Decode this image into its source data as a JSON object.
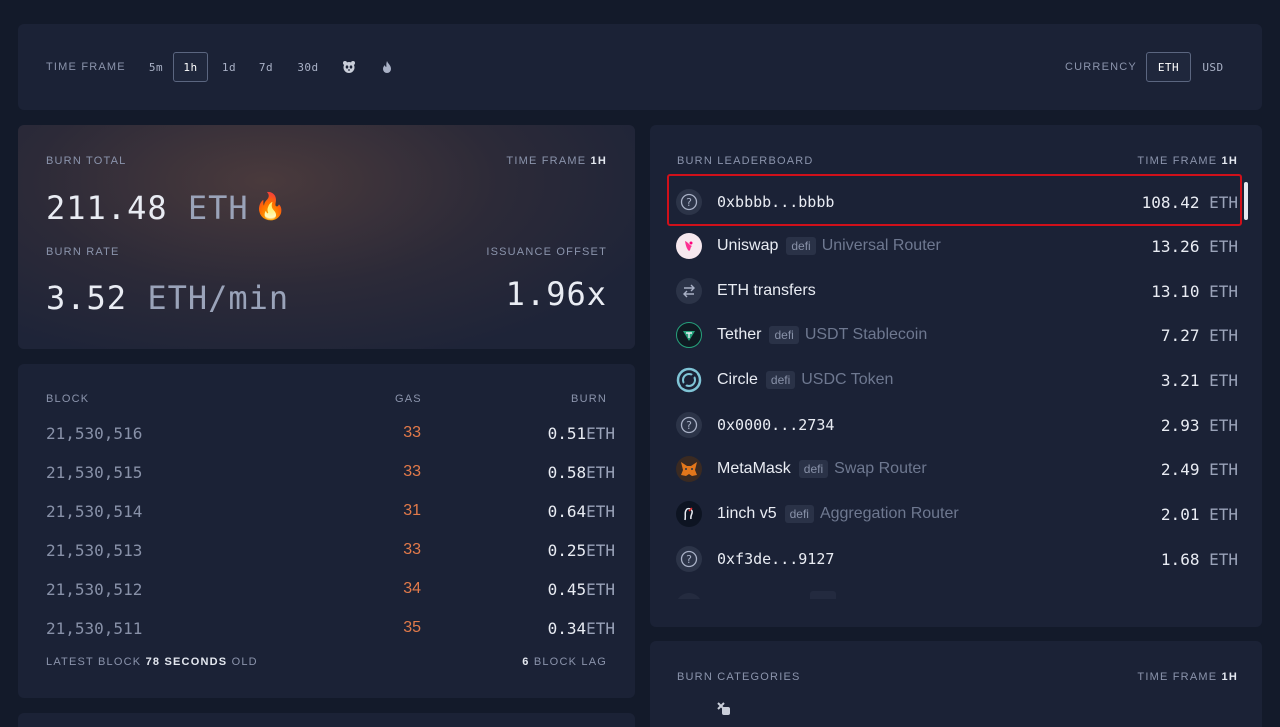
{
  "time_frame_bar": {
    "label": "TIME FRAME",
    "options": [
      "5m",
      "1h",
      "1d",
      "7d",
      "30d"
    ],
    "selected": "1h",
    "extra_icons": [
      "panda-icon",
      "fire-icon"
    ],
    "currency_label": "CURRENCY",
    "currency_options": [
      "ETH",
      "USD"
    ],
    "currency_selected": "ETH"
  },
  "burn_total": {
    "label": "BURN TOTAL",
    "time_frame_label": "TIME FRAME",
    "time_frame_value": "1h",
    "value": "211.48",
    "unit": "ETH",
    "emoji": "🔥",
    "burn_rate_label": "BURN RATE",
    "burn_rate_value": "3.52",
    "burn_rate_unit": "ETH/min",
    "issuance_offset_label": "ISSUANCE OFFSET",
    "issuance_offset_value": "1.96x"
  },
  "blocks": {
    "headers": {
      "block": "BLOCK",
      "gas": "GAS",
      "burn": "BURN"
    },
    "rows": [
      {
        "block": "21,530,516",
        "gas": "33",
        "burn": "0.51",
        "unit": "ETH"
      },
      {
        "block": "21,530,515",
        "gas": "33",
        "burn": "0.58",
        "unit": "ETH"
      },
      {
        "block": "21,530,514",
        "gas": "31",
        "burn": "0.64",
        "unit": "ETH"
      },
      {
        "block": "21,530,513",
        "gas": "33",
        "burn": "0.25",
        "unit": "ETH"
      },
      {
        "block": "21,530,512",
        "gas": "34",
        "burn": "0.45",
        "unit": "ETH"
      },
      {
        "block": "21,530,511",
        "gas": "35",
        "burn": "0.34",
        "unit": "ETH"
      }
    ],
    "footer_latest_prefix": "LATEST BLOCK",
    "footer_latest_value": "78",
    "footer_latest_unit": "SECONDS",
    "footer_latest_suffix": "OLD",
    "footer_lag_value": "6",
    "footer_lag_label": "BLOCK LAG"
  },
  "leaderboard": {
    "label": "BURN LEADERBOARD",
    "time_frame_label": "TIME FRAME",
    "time_frame_value": "1h",
    "rows": [
      {
        "icon": "question-icon",
        "name": "0xbbbb...bbbb",
        "mono": true,
        "tag": "",
        "desc": "",
        "amount": "108.42",
        "unit": "ETH"
      },
      {
        "icon": "uniswap-icon",
        "name": "Uniswap",
        "mono": false,
        "tag": "defi",
        "desc": "Universal Router",
        "amount": "13.26",
        "unit": "ETH"
      },
      {
        "icon": "transfer-icon",
        "name": "ETH transfers",
        "mono": false,
        "tag": "",
        "desc": "",
        "amount": "13.10",
        "unit": "ETH"
      },
      {
        "icon": "tether-icon",
        "name": "Tether",
        "mono": false,
        "tag": "defi",
        "desc": "USDT Stablecoin",
        "amount": "7.27",
        "unit": "ETH"
      },
      {
        "icon": "circle-icon",
        "name": "Circle",
        "mono": false,
        "tag": "defi",
        "desc": "USDC Token",
        "amount": "3.21",
        "unit": "ETH"
      },
      {
        "icon": "question-icon",
        "name": "0x0000...2734",
        "mono": true,
        "tag": "",
        "desc": "",
        "amount": "2.93",
        "unit": "ETH"
      },
      {
        "icon": "metamask-icon",
        "name": "MetaMask",
        "mono": false,
        "tag": "defi",
        "desc": "Swap Router",
        "amount": "2.49",
        "unit": "ETH"
      },
      {
        "icon": "1inch-icon",
        "name": "1inch v5",
        "mono": false,
        "tag": "defi",
        "desc": "Aggregation Router",
        "amount": "2.01",
        "unit": "ETH"
      },
      {
        "icon": "question-icon",
        "name": "0xf3de...9127",
        "mono": true,
        "tag": "",
        "desc": "",
        "amount": "1.68",
        "unit": "ETH"
      }
    ]
  },
  "categories": {
    "label": "BURN CATEGORIES",
    "time_frame_label": "TIME FRAME",
    "time_frame_value": "1h"
  },
  "colors": {
    "background": "#131a2a",
    "card": "#1b2236",
    "gas_orange": "#e27a4a",
    "highlight_red": "#d0101a"
  }
}
